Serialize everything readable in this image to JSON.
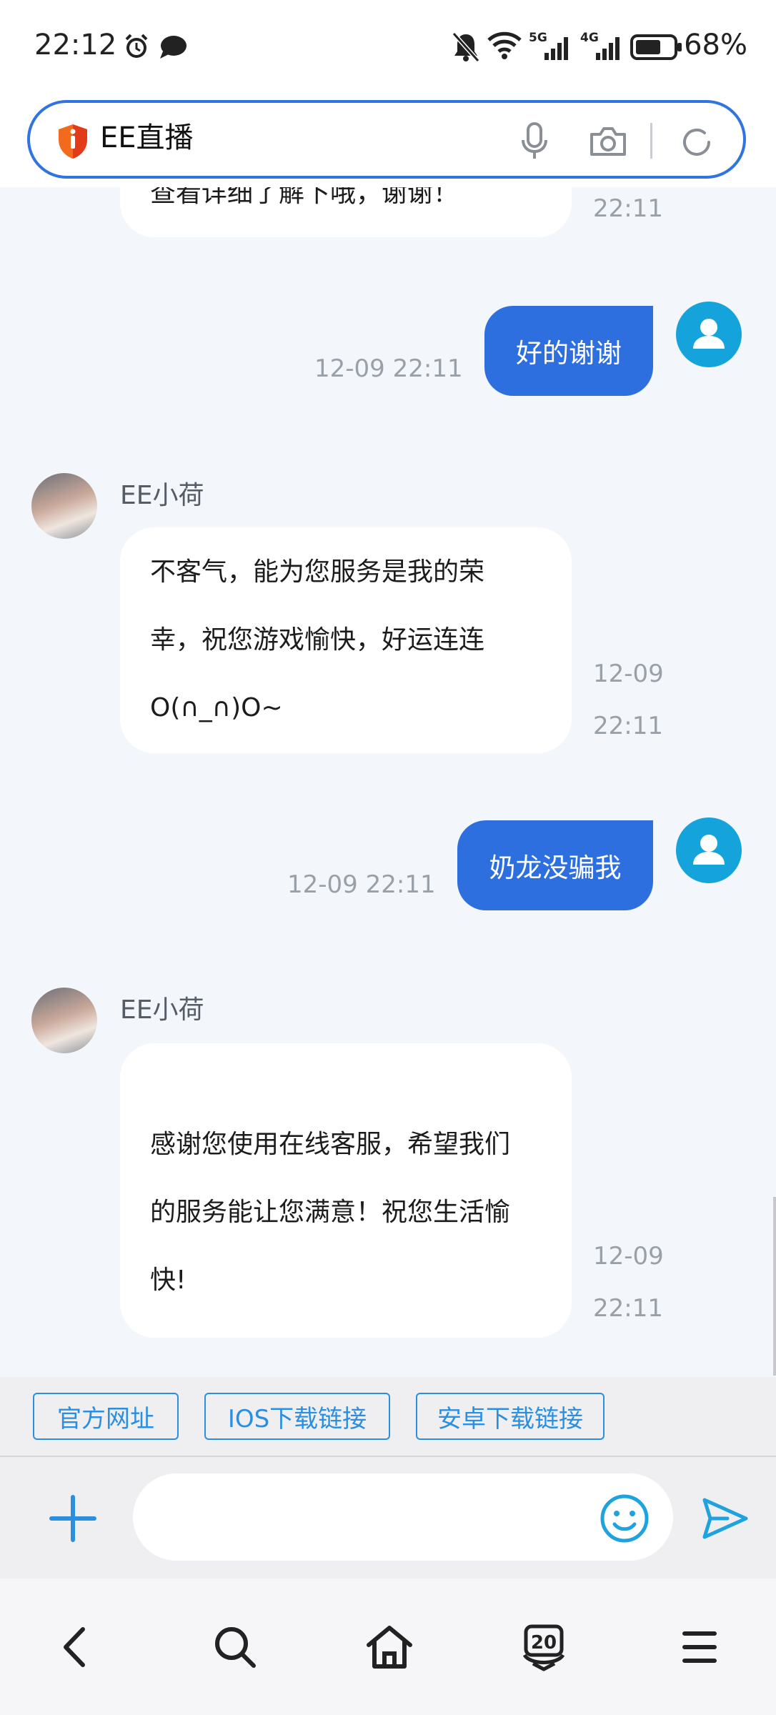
{
  "status_bar": {
    "time": "22:12",
    "battery": "68%",
    "left_icons": [
      "alarm-icon",
      "chat-bubble-icon"
    ],
    "right_icons": [
      "mute-bell-icon",
      "wifi-icon",
      "5g-signal-icon",
      "4g-signal-icon",
      "battery-icon"
    ]
  },
  "browser": {
    "search_text": "EE直播",
    "icons": [
      "shield-alert-icon",
      "microphone-icon",
      "camera-icon",
      "refresh-icon"
    ]
  },
  "chat": {
    "messages": [
      {
        "side": "in",
        "sender": "",
        "text": "查看详细了解下哦，谢谢！",
        "time": "22:11"
      },
      {
        "side": "out",
        "text": "好的谢谢",
        "time": "12-09 22:11"
      },
      {
        "side": "in",
        "sender": "EE小荷",
        "lines": [
          "不客气，能为您服务是我的荣",
          "幸，祝您游戏愉快，好运连连",
          "O(∩_∩)O~"
        ],
        "date": "12-09",
        "time": "22:11"
      },
      {
        "side": "out",
        "text": "奶龙没骗我",
        "time": "12-09 22:11"
      },
      {
        "side": "in",
        "sender": "EE小荷",
        "lines": [
          "感谢您使用在线客服，希望我们",
          "的服务能让您满意！祝您生活愉",
          "快!"
        ],
        "date": "12-09",
        "time": "22:11"
      }
    ]
  },
  "quick_links": [
    "官方网址",
    "IOS下载链接",
    "安卓下载链接"
  ],
  "input_bar": {
    "placeholder": "",
    "icons": [
      "plus-icon",
      "emoji-icon",
      "send-icon"
    ]
  },
  "nav_bar": {
    "tab_count": "20",
    "icons": [
      "back-icon",
      "search-icon",
      "home-icon",
      "tabs-icon",
      "menu-icon"
    ]
  },
  "colors": {
    "accent": "#2e6fe0",
    "link": "#2a8fe0",
    "avatar_user": "#14a3db",
    "chat_bg": "#f3f6fa"
  }
}
